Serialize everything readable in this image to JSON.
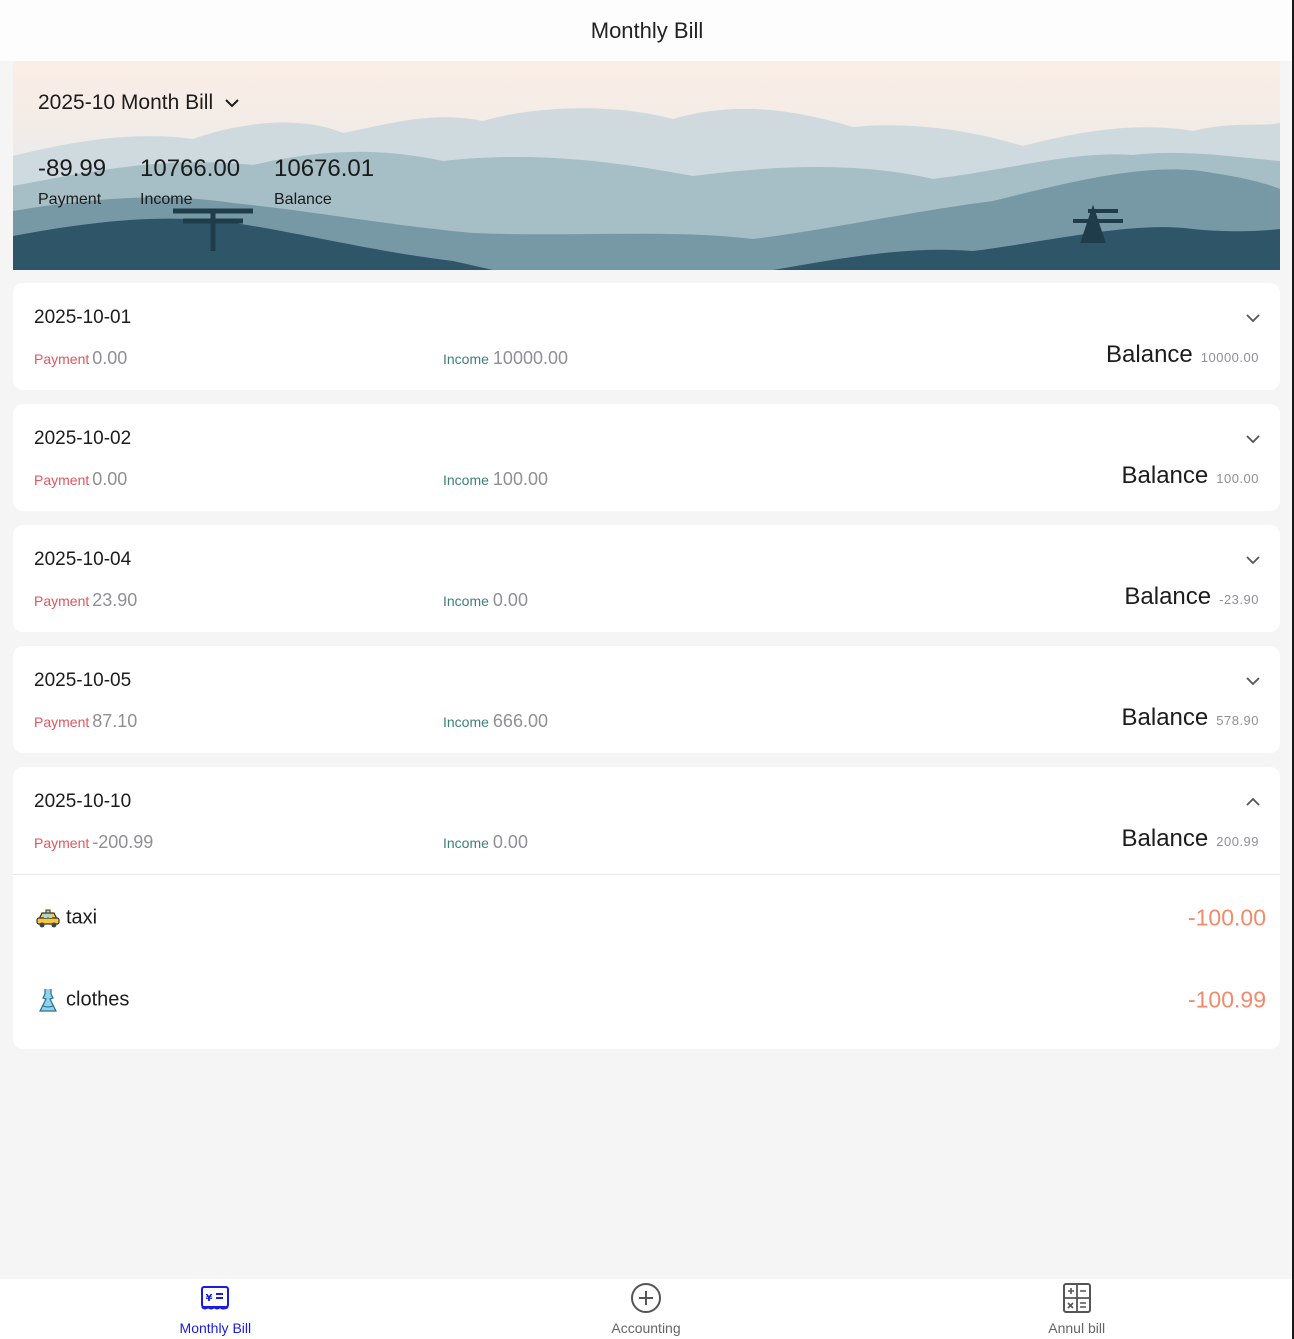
{
  "header": {
    "title": "Monthly Bill"
  },
  "summary": {
    "month_label": "2025-10 Month Bill",
    "payment_value": "-89.99",
    "payment_label": "Payment",
    "income_value": "10766.00",
    "income_label": "Income",
    "balance_value": "10676.01",
    "balance_label": "Balance"
  },
  "labels": {
    "payment": "Payment",
    "income": "Income",
    "balance": "Balance"
  },
  "days": [
    {
      "date": "2025-10-01",
      "payment": "0.00",
      "income": "10000.00",
      "balance": "10000.00",
      "expanded": false
    },
    {
      "date": "2025-10-02",
      "payment": "0.00",
      "income": "100.00",
      "balance": "100.00",
      "expanded": false
    },
    {
      "date": "2025-10-04",
      "payment": "23.90",
      "income": "0.00",
      "balance": "-23.90",
      "expanded": false
    },
    {
      "date": "2025-10-05",
      "payment": "87.10",
      "income": "666.00",
      "balance": "578.90",
      "expanded": false
    },
    {
      "date": "2025-10-10",
      "payment": "-200.99",
      "income": "0.00",
      "balance": "200.99",
      "expanded": true,
      "items": [
        {
          "name": "taxi",
          "amount": "-100.00",
          "icon": "taxi-icon"
        },
        {
          "name": "clothes",
          "amount": "-100.99",
          "icon": "dress-icon"
        }
      ]
    }
  ],
  "tabs": [
    {
      "label": "Monthly Bill",
      "icon": "bill-icon",
      "active": true
    },
    {
      "label": "Accounting",
      "icon": "plus-circle-icon",
      "active": false
    },
    {
      "label": "Annul bill",
      "icon": "calculator-icon",
      "active": false
    }
  ],
  "colors": {
    "payment_label": "#e0565f",
    "income_label": "#3d8079",
    "item_amount": "#f28a6c",
    "active_tab": "#1a1ae6"
  }
}
